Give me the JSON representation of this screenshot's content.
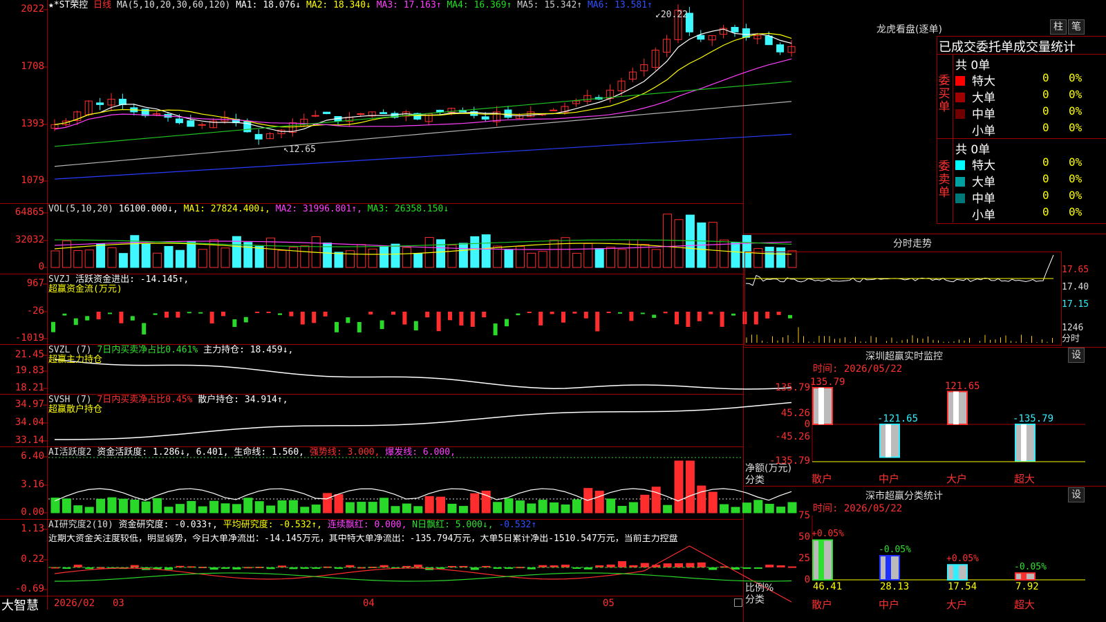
{
  "colors": {
    "up": "#ff2d2d",
    "down": "#3ff8ff",
    "green": "#2ad82a",
    "white": "#ffffff",
    "yellow": "#ffff00",
    "magenta": "#ff40ff",
    "darkgreen": "#20c020",
    "gray": "#b4b4b4",
    "blue": "#2a3cff"
  },
  "main": {
    "stock_name": "★*ST荣控",
    "period": "日线",
    "ma_title": "MA(5,10,20,30,60,120)",
    "ma1": "MA1: 18.076↓",
    "ma2": "MA2: 18.340↓",
    "ma3": "MA3: 17.163↑",
    "ma4": "MA4: 16.369↑",
    "ma5": "MA5: 15.342↑",
    "ma6": "MA6: 13.581↑",
    "high_label": "20.22",
    "low_label": "12.65",
    "y_ticks": [
      "2022",
      "1708",
      "1393",
      "1079"
    ]
  },
  "vol": {
    "title": "VOL(5,10,20)",
    "val": "16100.000↓,",
    "ma1": "MA1: 27824.400↓,",
    "ma2": "MA2: 31996.801↑,",
    "ma3": "MA3: 26358.150↓",
    "y_ticks": [
      "64865",
      "32032",
      "0"
    ]
  },
  "svzj": {
    "title": "SVZJ",
    "t1": "活跃资金进出: -14.145↑,",
    "t2": "超赢资金流(万元)",
    "y_ticks": [
      "967",
      "-26",
      "-1019"
    ]
  },
  "svzl": {
    "title": "SVZL (7)",
    "t1": "7日内买卖净占比0.461%",
    "t2": "主力持仓: 18.459↓,",
    "t3": "超赢主力持仓",
    "y_ticks": [
      "21.45",
      "19.83",
      "18.21"
    ]
  },
  "svsh": {
    "title": "SVSH (7)",
    "t1": "7日内买卖净占比0.45%",
    "t2": "散户持仓: 34.914↑,",
    "t3": "超赢散户持仓",
    "y_ticks": [
      "34.97",
      "34.04",
      "33.14"
    ]
  },
  "ai1": {
    "title": "AI活跃度2",
    "t1": "资金活跃度: 1.286↓, 6.401,",
    "t2": "生命线: 1.560,",
    "t3": "强势线: 3.000,",
    "t4": "爆发线: 6.000,",
    "y_ticks": [
      "6.40",
      "3.16",
      "0.00"
    ]
  },
  "ai2": {
    "title": "AI研究度2(10)",
    "t1": "资金研究度: -0.033↑,",
    "t2": "平均研究度: -0.532↑,",
    "t3": "连续飘红: 0.000,",
    "t4": "N日飘红: 5.000↓,",
    "t5": "-0.532↑",
    "note": "近期大资金关注度较低，明显弱势，今日大单净流出：-14.145万元，其中特大单净流出：-135.794万元，大单5日累计净出-1510.547万元，当前主力控盘",
    "y_ticks": [
      "1.13",
      "0.22",
      "-0.69"
    ]
  },
  "bottom": {
    "brand": "大智慧",
    "dates": [
      "2026/02",
      "03",
      "04",
      "05"
    ]
  },
  "right": {
    "lhb_title": "龙虎看盘(逐单)",
    "btn_zhu": "柱",
    "btn_pen": "笔",
    "header": "已成交委托单成交量统计",
    "buy_side": "委买单",
    "sell_side": "委卖单",
    "buy_total": "共 0单",
    "sell_total": "共 0单",
    "buy_rows": [
      {
        "label": "特大",
        "n": "0",
        "p": "0%",
        "c": "#ff0000"
      },
      {
        "label": "大单",
        "n": "0",
        "p": "0%",
        "c": "#a00000"
      },
      {
        "label": "中单",
        "n": "0",
        "p": "0%",
        "c": "#700000"
      },
      {
        "label": "小单",
        "n": "0",
        "p": "0%",
        "c": "#000000"
      }
    ],
    "sell_rows": [
      {
        "label": "特大",
        "n": "0",
        "p": "0%",
        "c": "#00ffff"
      },
      {
        "label": "大单",
        "n": "0",
        "p": "0%",
        "c": "#00a0a0"
      },
      {
        "label": "中单",
        "n": "0",
        "p": "0%",
        "c": "#007878"
      },
      {
        "label": "小单",
        "n": "0",
        "p": "0%",
        "c": "#000000"
      }
    ],
    "fs_title": "分时走势",
    "fs_ticks": [
      "17.65",
      "17.40",
      "17.15",
      "1246"
    ],
    "fs_unit": "分时",
    "sz_title": "深圳超赢实时监控",
    "sz_set": "设",
    "sz_time": "时间: 2026/05/22",
    "sz_ticks": [
      "135.79",
      "45.26",
      "0",
      "-45.26",
      "-135.79"
    ],
    "sz_ylabel1": "净额(万元)",
    "sz_ylabel2": "分类",
    "sz_bars": [
      {
        "cat": "散户",
        "label": "135.79",
        "v": 135.79
      },
      {
        "cat": "中户",
        "label": "-121.65",
        "v": -121.65
      },
      {
        "cat": "大户",
        "label": "121.65",
        "v": 121.65
      },
      {
        "cat": "超大",
        "label": "-135.79",
        "v": -135.79
      }
    ],
    "ss_title": "深市超赢分类统计",
    "ss_set": "设",
    "ss_time": "时间: 2026/05/22",
    "ss_ticks": [
      "75",
      "50",
      "25",
      "0"
    ],
    "ss_ylabel1": "比例%",
    "ss_ylabel2": "分类",
    "ss_bars": [
      {
        "cat": "散户",
        "top": "+0.05%",
        "bottom": "46.41",
        "v": 46.41,
        "c": "#30e030"
      },
      {
        "cat": "中户",
        "top": "-0.05%",
        "bottom": "28.13",
        "v": 28.13,
        "c": "#2030ff"
      },
      {
        "cat": "大户",
        "top": "+0.05%",
        "bottom": "17.54",
        "v": 17.54,
        "c": "#30f0ff"
      },
      {
        "cat": "超大",
        "top": "-0.05%",
        "bottom": "7.92",
        "v": 7.92,
        "c": "#ff3030"
      }
    ]
  }
}
